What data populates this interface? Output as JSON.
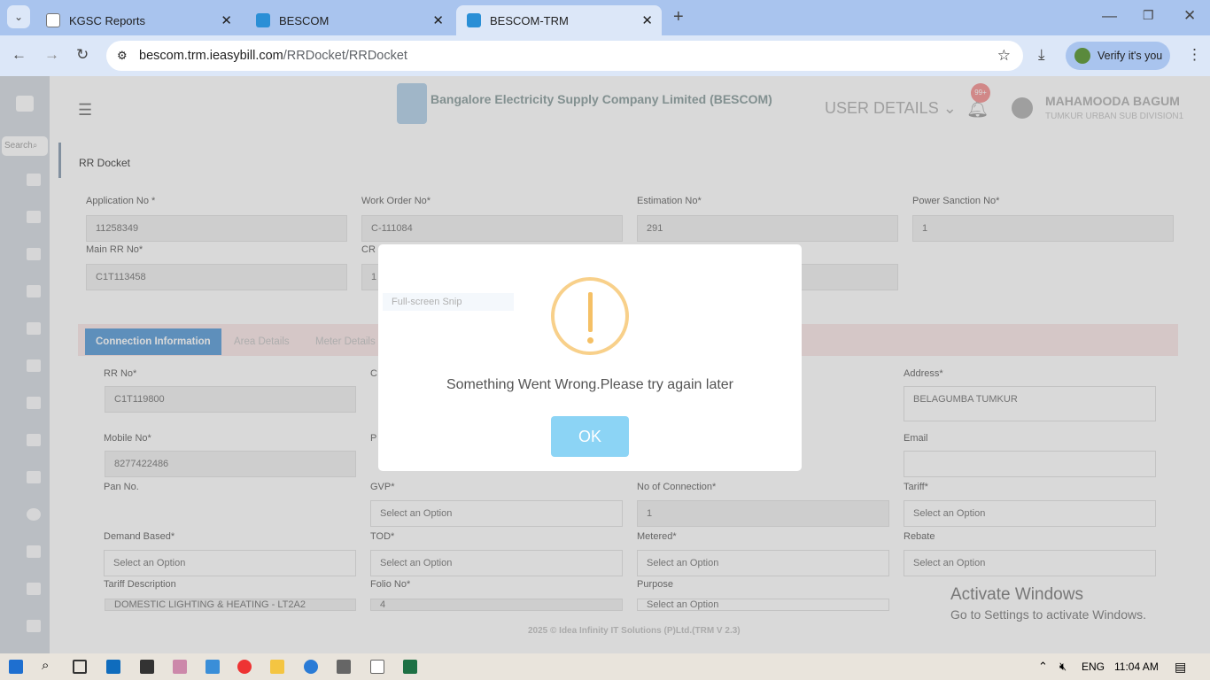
{
  "browser": {
    "tabs": [
      {
        "label": "KGSC Reports"
      },
      {
        "label": "BESCOM"
      },
      {
        "label": "BESCOM-TRM",
        "active": true
      }
    ],
    "url_host": "bescom.trm.ieasybill.com",
    "url_path": "/RRDocket/RRDocket",
    "verify_label": "Verify it's you"
  },
  "header": {
    "company": "Bangalore Electricity Supply Company Limited (BESCOM)",
    "user_details": "USER DETAILS",
    "user_name": "MAHAMOODA BAGUM",
    "division": "TUMKUR URBAN SUB DIVISION1",
    "search_placeholder": "Search",
    "notif_badge": "99+"
  },
  "breadcrumb": "RR Docket",
  "top_form": {
    "application_no_label": "Application No *",
    "application_no": "11258349",
    "work_order_label": "Work Order No*",
    "work_order": "C-111084",
    "estimation_label": "Estimation No*",
    "estimation": "291",
    "power_sanction_label": "Power Sanction No*",
    "power_sanction": "1",
    "main_rr_label": "Main RR No*",
    "main_rr": "C1T113458",
    "cr_label": "CR",
    "cr_value": "1",
    "snip_tooltip": "Full-screen Snip"
  },
  "tabs": [
    "Connection Information",
    "Area Details",
    "Meter Details"
  ],
  "conn_form": {
    "rr_no_label": "RR No*",
    "rr_no": "C1T119800",
    "c_label": "C",
    "address_label": "Address*",
    "address": "BELAGUMBA TUMKUR",
    "mobile_label": "Mobile No*",
    "mobile": "8277422486",
    "p_label": "P",
    "email_label": "Email",
    "pan_label": "Pan No.",
    "gvp_label": "GVP*",
    "gvp": "Select an Option",
    "noc_label": "No of Connection*",
    "noc": "1",
    "tariff_label": "Tariff*",
    "tariff": "Select an Option",
    "demand_label": "Demand Based*",
    "demand": "Select an Option",
    "tod_label": "TOD*",
    "tod": "Select an Option",
    "metered_label": "Metered*",
    "metered": "Select an Option",
    "rebate_label": "Rebate",
    "rebate": "Select an Option",
    "tariff_desc_label": "Tariff Description",
    "tariff_desc": "DOMESTIC LIGHTING & HEATING - LT2A2",
    "folio_label": "Folio No*",
    "folio": "4",
    "purpose_label": "Purpose",
    "purpose": "Select an Option"
  },
  "footer": "2025 © Idea Infinity IT Solutions (P)Ltd.(TRM V 2.3)",
  "modal": {
    "message": "Something Went Wrong.Please try again later",
    "ok": "OK",
    "warning_color": "#f8d08a",
    "ok_color": "#8cd4f5"
  },
  "watermark": {
    "title": "Activate Windows",
    "subtitle": "Go to Settings to activate Windows."
  },
  "taskbar": {
    "lang": "ENG",
    "time": "11:04 AM"
  }
}
